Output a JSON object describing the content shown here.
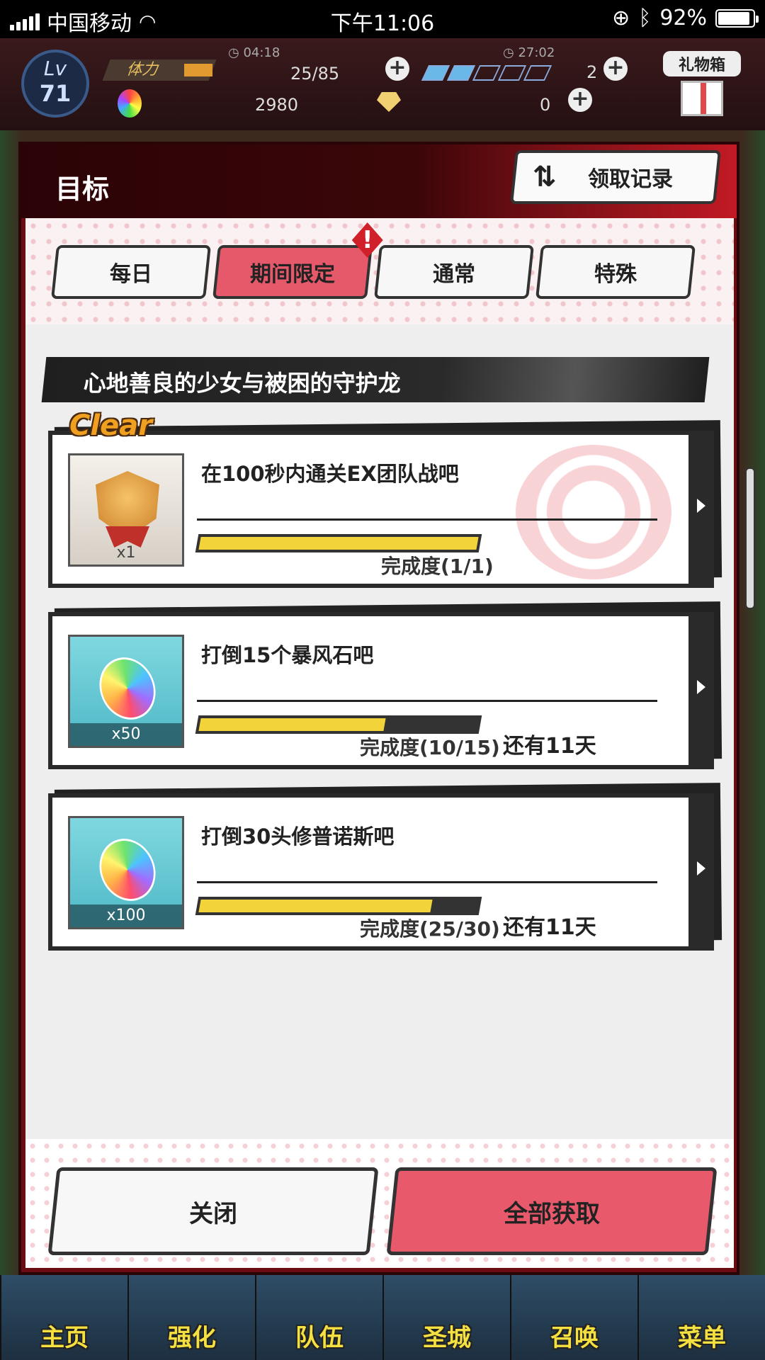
{
  "status_bar": {
    "carrier": "中国移动",
    "time": "下午11:06",
    "battery": "92%",
    "battery_level": 0.92
  },
  "header": {
    "level_label": "Lv",
    "level": "71",
    "stamina_label": "体力",
    "stamina_timer": "04:18",
    "stamina_value": "25/85",
    "bolt_timer": "27:02",
    "bolt_value": "2",
    "gem_value": "2980",
    "crystal_value": "0",
    "gift_label": "礼物箱"
  },
  "modal": {
    "title": "目标",
    "history_button": "领取记录",
    "tabs": [
      {
        "label": "每日",
        "active": false
      },
      {
        "label": "期间限定",
        "active": true,
        "alert": "!"
      },
      {
        "label": "通常",
        "active": false
      },
      {
        "label": "特殊",
        "active": false
      }
    ],
    "section_title": "心地善良的少女与被困的守护龙",
    "missions": [
      {
        "clear_tag": "Clear",
        "reward_qty": "x1",
        "title": "在100秒内通关EX团队战吧",
        "progress_text": "完成度(1/1)",
        "progress": 1.0,
        "days_left": ""
      },
      {
        "clear_tag": "",
        "reward_qty": "x50",
        "title": "打倒15个暴风石吧",
        "progress_text": "完成度(10/15)",
        "progress": 0.6667,
        "days_left": "还有11天"
      },
      {
        "clear_tag": "",
        "reward_qty": "x100",
        "title": "打倒30头修普诺斯吧",
        "progress_text": "完成度(25/30)",
        "progress": 0.8333,
        "days_left": "还有11天"
      }
    ],
    "close_button": "关闭",
    "claim_all_button": "全部获取"
  },
  "bottom_nav": [
    "主页",
    "强化",
    "队伍",
    "圣城",
    "召唤",
    "菜单"
  ],
  "colors": {
    "accent_pink": "#e5596b",
    "progress_yellow": "#f2d43a",
    "modal_red": "#6a0c12"
  }
}
